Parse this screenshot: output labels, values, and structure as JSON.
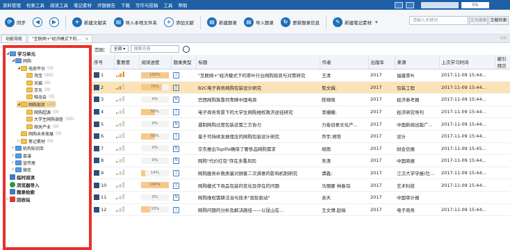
{
  "menubar": {
    "items": [
      "资料管理",
      "检索工具",
      "阅读工具",
      "笔记素材",
      "开题报告",
      "下载",
      "写作与投稿",
      "工具",
      "帮助"
    ],
    "zoom_value": "5%"
  },
  "toolbar": {
    "buttons": [
      {
        "label": "同步",
        "icon": "sync-icon"
      },
      {
        "label": "",
        "icon": "back-icon"
      },
      {
        "label": "",
        "icon": "forward-icon"
      },
      {
        "label": "新建文献夹",
        "icon": "new-folder-icon"
      },
      {
        "label": "导入本地文件夹",
        "icon": "import-folder-icon"
      },
      {
        "label": "添加文献",
        "icon": "add-icon"
      },
      {
        "label": "新建题录",
        "icon": "new-record-icon"
      },
      {
        "label": "导入题录",
        "icon": "import-record-icon"
      },
      {
        "label": "更新题录信息",
        "icon": "update-icon"
      },
      {
        "label": "新建笔记素材",
        "icon": "new-note-icon"
      }
    ],
    "search_placeholder": "请输入关键词",
    "search_btn_1": "文内搜索",
    "search_btn_2": "文献检索"
  },
  "tabs": [
    {
      "label": "功能导航"
    },
    {
      "label": "\"互联网+\"经济模式下的..."
    }
  ],
  "tabs_nav": "◁ ▷",
  "sidebar": {
    "items": [
      {
        "label": "学习单元",
        "count": ""
      },
      {
        "label": "网购",
        "count": ""
      },
      {
        "label": "电商平台",
        "count": "(0)"
      },
      {
        "label": "淘宝",
        "count": "(40)"
      },
      {
        "label": "天猫",
        "count": "(0)"
      },
      {
        "label": "京东",
        "count": "(0)"
      },
      {
        "label": "唯品会",
        "count": "(0)"
      },
      {
        "label": "网购现状",
        "count": "(20)"
      },
      {
        "label": "网购超源",
        "count": "(0)"
      },
      {
        "label": "大学生网购调查",
        "count": "(20)"
      },
      {
        "label": "相关产业",
        "count": "(0)"
      },
      {
        "label": "网购未来发展",
        "count": "(0)"
      },
      {
        "label": "笔记素材",
        "count": "(0)"
      },
      {
        "label": "机构知识库",
        "count": ""
      },
      {
        "label": "慕课",
        "count": ""
      },
      {
        "label": "宣传册",
        "count": ""
      },
      {
        "label": "微信",
        "count": ""
      },
      {
        "label": "临时阅读",
        "count": ""
      },
      {
        "label": "浏览器导入",
        "count": ""
      },
      {
        "label": "题录检索",
        "count": ""
      },
      {
        "label": "回收站",
        "count": ""
      }
    ]
  },
  "filter": {
    "label": "范围：",
    "scope": "全部",
    "placeholder": "搜索内容"
  },
  "table": {
    "headers": [
      "序号",
      "重要度",
      "阅读进度",
      "题录类型",
      "标题",
      "作者",
      "出版年",
      "来源",
      "上次学习时间",
      "被引频次"
    ],
    "rows": [
      {
        "n": "1",
        "imp": 5,
        "prog": 100,
        "prog_label": "100%",
        "type": "J",
        "title": "\"互联网+\"经济模式下的茶叶行业网购现状与对策研究",
        "author": "王清",
        "year": "2017",
        "source": "福建茶叶",
        "time": "2017-11-09 15:44...",
        "cite": ""
      },
      {
        "n": "2",
        "imp": 3,
        "prog": 75,
        "prog_label": "75%",
        "type": "J",
        "title": "B2C电子商务网购包装设计研究",
        "author": "詹文娟;",
        "year": "2017",
        "source": "包装工程",
        "time": "2017-11-09 15:44...",
        "cite": ""
      },
      {
        "n": "3",
        "imp": 1,
        "prog": 0,
        "prog_label": "0%",
        "type": "N",
        "title": "巴西网购族靠何青睐中国电商",
        "author": "陈晓晓",
        "year": "2017",
        "source": "经济参考报",
        "time": "2017-11-09 15:44...",
        "cite": ""
      },
      {
        "n": "4",
        "imp": 1,
        "prog": 50,
        "prog_label": "50%",
        "type": "J",
        "title": "电子商务背景下的大学生网购维权救济途径研究",
        "author": "李姗姗;",
        "year": "2017",
        "source": "经济研究导刊",
        "time": "2017-11-09 15:44...",
        "cite": ""
      },
      {
        "n": "5",
        "imp": 1,
        "prog": 0,
        "prog_label": "0%",
        "type": "N",
        "title": "遏制网购过度包装还需三方协力",
        "author": "力卷创意文化产...",
        "year": "2017",
        "source": "中国新闻出版广...",
        "time": "2017-11-09 15:44...",
        "cite": ""
      },
      {
        "n": "6",
        "imp": 1,
        "prog": 50,
        "prog_label": "50%",
        "type": "J",
        "title": "基于可持续发展理念的网购包装设计研究",
        "author": "乔宇;郑哲",
        "year": "2017",
        "source": "设计",
        "time": "2017-11-09 15:44...",
        "cite": ""
      },
      {
        "n": "7",
        "imp": 1,
        "prog": 0,
        "prog_label": "0%",
        "type": "N",
        "title": "京东推出Topilfe确保了奢侈品网购需求",
        "author": "胡雨",
        "year": "2017",
        "source": "财会信报",
        "time": "2017-11-09 15:45...",
        "cite": ""
      },
      {
        "n": "8",
        "imp": 1,
        "prog": 0,
        "prog_label": "0%",
        "type": "N",
        "title": "网购\"代价红包\"存在多重风险",
        "author": "朱清",
        "year": "2017",
        "source": "中国商报",
        "time": "2017-11-09 15:44...",
        "cite": ""
      },
      {
        "n": "9",
        "imp": 1,
        "prog": 14,
        "prog_label": "14%",
        "type": "J",
        "title": "网购服务补救质量对顾客二次满意的影响机制研究",
        "author": "谭鑫;",
        "year": "2017",
        "source": "江汉大学学报(社...",
        "time": "2017-11-09 15:44...",
        "cite": ""
      },
      {
        "n": "10",
        "imp": 1,
        "prog": 100,
        "prog_label": "100%",
        "type": "J",
        "title": "网购模式下商品包装的变化及存在的问题",
        "author": "马丽娜 林春羽",
        "year": "2017",
        "source": "艺术科技",
        "time": "2017-11-09 15:44...",
        "cite": ""
      },
      {
        "n": "11",
        "imp": 1,
        "prog": 0,
        "prog_label": "0%",
        "type": "N",
        "title": "网购维权需耕法治与技术\"双轮驱动\"",
        "author": "赤天",
        "year": "2017",
        "source": "中国审计报",
        "time": "",
        "cite": ""
      },
      {
        "n": "12",
        "imp": 1,
        "prog": 33,
        "prog_label": "33%",
        "type": "J",
        "title": "网购问题的分析及解决路径——以昆山在...",
        "author": "王文博;赵喻",
        "year": "2017",
        "source": "电子商务",
        "time": "2017-11-09 15:44...",
        "cite": ""
      }
    ]
  }
}
